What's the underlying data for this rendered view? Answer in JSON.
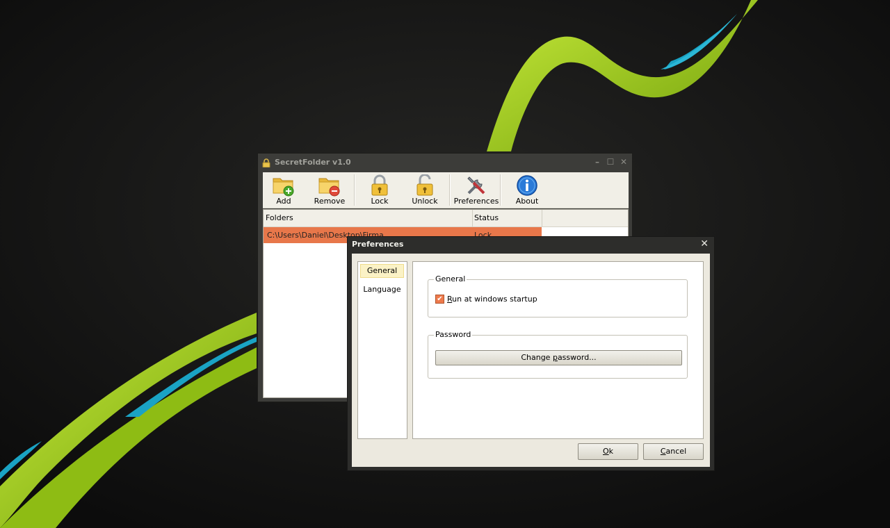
{
  "main_window": {
    "title": "SecretFolder v1.0",
    "toolbar": {
      "add": "Add",
      "remove": "Remove",
      "lock": "Lock",
      "unlock": "Unlock",
      "preferences": "Preferences",
      "about": "About"
    },
    "list": {
      "columns": [
        "Folders",
        "Status"
      ],
      "rows": [
        {
          "folder": "C:\\Users\\Daniel\\Desktop\\Firma",
          "status": "Lock"
        }
      ]
    }
  },
  "preferences_dialog": {
    "title": "Preferences",
    "nav": [
      "General",
      "Language"
    ],
    "general_group": {
      "title": "General",
      "run_at_startup_first": "R",
      "run_at_startup_rest": "un at windows startup",
      "run_at_startup_checked": true
    },
    "password_group": {
      "title": "Password",
      "change_before": "Change ",
      "change_accel": "p",
      "change_after": "assword..."
    },
    "ok_accel": "O",
    "ok_rest": "k",
    "cancel_accel": "C",
    "cancel_rest": "ancel"
  },
  "colors": {
    "selection": "#e8774a",
    "wallpaper_green": "#9ccc1a",
    "wallpaper_cyan": "#1aa3c4"
  }
}
